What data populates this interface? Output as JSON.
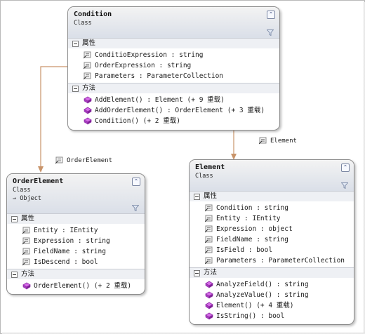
{
  "diagram": {
    "classes": [
      {
        "id": "condition",
        "name": "Condition",
        "kind": "Class",
        "base": null,
        "sections": [
          {
            "title": "属性",
            "kind": "property",
            "members": [
              "ConditioExpression : string",
              "OrderExpression : string",
              "Parameters : ParameterCollection"
            ]
          },
          {
            "title": "方法",
            "kind": "method",
            "members": [
              "AddElement() : Element (+ 9 重载)",
              "AddOrderElement() : OrderElement (+ 3 重载)",
              "Condition() (+ 2 重载)"
            ]
          }
        ]
      },
      {
        "id": "orderelement",
        "name": "OrderElement",
        "kind": "Class",
        "base": "⇒ Object",
        "sections": [
          {
            "title": "属性",
            "kind": "property",
            "members": [
              "Entity : IEntity",
              "Expression : string",
              "FieldName : string",
              "IsDescend : bool"
            ]
          },
          {
            "title": "方法",
            "kind": "method",
            "members": [
              "OrderElement() (+ 2 重载)"
            ]
          }
        ]
      },
      {
        "id": "element",
        "name": "Element",
        "kind": "Class",
        "base": null,
        "sections": [
          {
            "title": "属性",
            "kind": "property",
            "members": [
              "Condition : string",
              "Entity : IEntity",
              "Expression : object",
              "FieldName : string",
              "IsField : bool",
              "Parameters : ParameterCollection"
            ]
          },
          {
            "title": "方法",
            "kind": "method",
            "members": [
              "AnalyzeField() : string",
              "AnalyzeValue() : string",
              "Element() (+ 4 重载)",
              "IsString() : bool"
            ]
          }
        ]
      }
    ],
    "associations": [
      {
        "from": "condition",
        "to": "orderelement",
        "label": "OrderElement"
      },
      {
        "from": "condition",
        "to": "element",
        "label": "Element"
      }
    ],
    "colors": {
      "connector": "#c9946a",
      "header_top": "#f3f3f3",
      "header_bottom": "#dadfe8",
      "property_icon": "#8a8a8a",
      "method_icon": "#b23ccf"
    }
  }
}
